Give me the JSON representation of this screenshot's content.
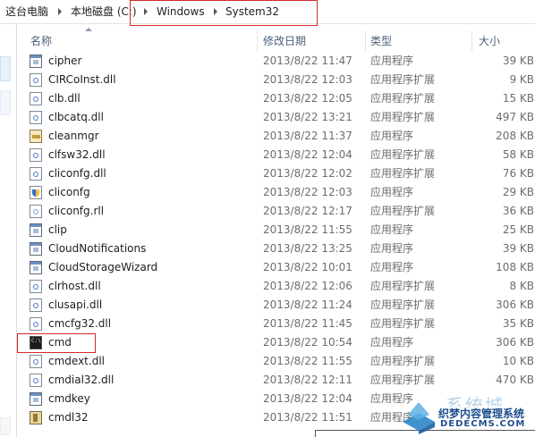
{
  "breadcrumb": {
    "items": [
      "这台电脑",
      "本地磁盘 (C:)",
      "Windows",
      "System32"
    ]
  },
  "columns": {
    "name": "名称",
    "date": "修改日期",
    "type": "类型",
    "size": "大小"
  },
  "files": [
    {
      "name": "cipher",
      "date": "2013/8/22 11:47",
      "type": "应用程序",
      "size": "39 KB",
      "icon": "exe"
    },
    {
      "name": "CIRCoInst.dll",
      "date": "2013/8/22 12:03",
      "type": "应用程序扩展",
      "size": "9 KB",
      "icon": "dll"
    },
    {
      "name": "clb.dll",
      "date": "2013/8/22 12:05",
      "type": "应用程序扩展",
      "size": "15 KB",
      "icon": "dll"
    },
    {
      "name": "clbcatq.dll",
      "date": "2013/8/22 13:21",
      "type": "应用程序扩展",
      "size": "497 KB",
      "icon": "dll"
    },
    {
      "name": "cleanmgr",
      "date": "2013/8/22 11:37",
      "type": "应用程序",
      "size": "208 KB",
      "icon": "clean"
    },
    {
      "name": "clfsw32.dll",
      "date": "2013/8/22 12:04",
      "type": "应用程序扩展",
      "size": "58 KB",
      "icon": "dll"
    },
    {
      "name": "cliconfg.dll",
      "date": "2013/8/22 12:02",
      "type": "应用程序扩展",
      "size": "76 KB",
      "icon": "dll"
    },
    {
      "name": "cliconfg",
      "date": "2013/8/22 12:03",
      "type": "应用程序",
      "size": "29 KB",
      "icon": "shield"
    },
    {
      "name": "cliconfg.rll",
      "date": "2013/8/22 12:17",
      "type": "应用程序扩展",
      "size": "36 KB",
      "icon": "rll"
    },
    {
      "name": "clip",
      "date": "2013/8/22 11:55",
      "type": "应用程序",
      "size": "25 KB",
      "icon": "exe"
    },
    {
      "name": "CloudNotifications",
      "date": "2013/8/22 13:25",
      "type": "应用程序",
      "size": "39 KB",
      "icon": "exe"
    },
    {
      "name": "CloudStorageWizard",
      "date": "2013/8/22 10:01",
      "type": "应用程序",
      "size": "108 KB",
      "icon": "exe"
    },
    {
      "name": "clrhost.dll",
      "date": "2013/8/22 12:06",
      "type": "应用程序扩展",
      "size": "8 KB",
      "icon": "dll"
    },
    {
      "name": "clusapi.dll",
      "date": "2013/8/22 11:24",
      "type": "应用程序扩展",
      "size": "306 KB",
      "icon": "dll"
    },
    {
      "name": "cmcfg32.dll",
      "date": "2013/8/22 11:45",
      "type": "应用程序扩展",
      "size": "35 KB",
      "icon": "dll"
    },
    {
      "name": "cmd",
      "date": "2013/8/22 10:54",
      "type": "应用程序",
      "size": "306 KB",
      "icon": "cmd"
    },
    {
      "name": "cmdext.dll",
      "date": "2013/8/22 11:55",
      "type": "应用程序扩展",
      "size": "10 KB",
      "icon": "dll"
    },
    {
      "name": "cmdial32.dll",
      "date": "2013/8/22 12:11",
      "type": "应用程序扩展",
      "size": "470 KB",
      "icon": "dll"
    },
    {
      "name": "cmdkey",
      "date": "2013/8/22 12:04",
      "type": "应用程序",
      "size": "",
      "icon": "exe"
    },
    {
      "name": "cmdl32",
      "date": "2013/8/22 11:51",
      "type": "应用程序",
      "size": "",
      "icon": "dl"
    }
  ],
  "watermark": {
    "line1": "系统城",
    "line2": "织梦内容管理系统",
    "line3": "DEDECMS.COM"
  }
}
